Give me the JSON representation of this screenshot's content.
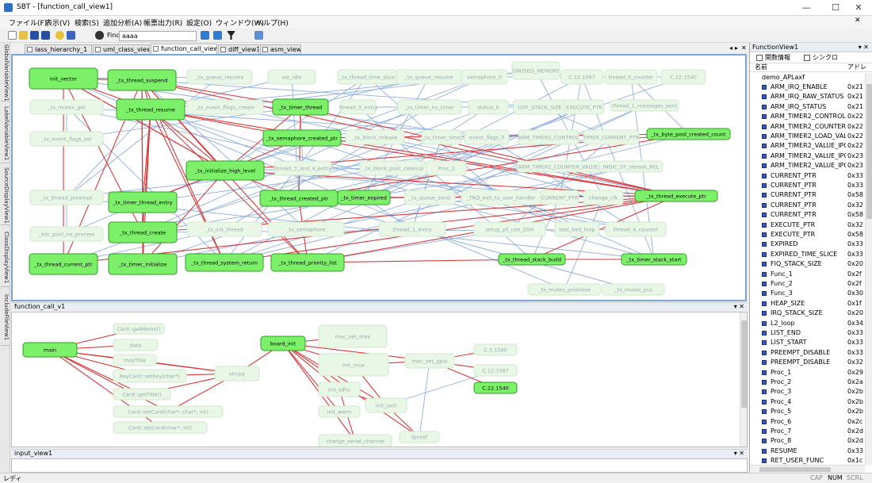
{
  "window": {
    "title": "SBT - [function_call_view1]",
    "min": "—",
    "max": "☐",
    "close": "✕"
  },
  "menu": [
    "ファイル(F)",
    "表示(V)",
    "検索(S)",
    "追加分析(A)",
    "帳票出力(R)",
    "設定(O)",
    "ウィンドウ(W)",
    "ヘルプ(H)"
  ],
  "toolbar": {
    "find_label": "Find",
    "find_value": "aaaa",
    "btn1": "PREV",
    "btn2": "NEXT"
  },
  "side_tabs": [
    "GlobalVariableView1",
    "LabelVariableView1",
    "SourceDisplayView1",
    "ClassDisplayView1",
    "IncludeFileView1"
  ],
  "tabs": [
    "lass_hierarchy_1",
    "uml_class_view",
    "function_call_view1",
    "diff_view1",
    "asm_view1"
  ],
  "tab_ctrl": {
    "left": "◂",
    "right": "▸",
    "close": "✕"
  },
  "graph1_nodes": [
    {
      "label": "init_vector",
      "hl": true
    },
    {
      "label": "_tx_thread_suspend",
      "hl": true
    },
    {
      "label": "_tx_thread_resume",
      "hl": true
    },
    {
      "label": "_tx_timer_thread",
      "hl": true
    },
    {
      "label": "_tx_semaphore_created_ptr",
      "hl": true
    },
    {
      "label": "_tx_initialize_high_level",
      "hl": true
    },
    {
      "label": "_tx_byte_pool_created_count",
      "hl": true
    },
    {
      "label": "_tx_thread_created_ptr",
      "hl": true
    },
    {
      "label": "_tx_timer_expired",
      "hl": true
    },
    {
      "label": "_tx_thread_execute_ptr",
      "hl": true
    },
    {
      "label": "_tx_timer_thread_entry",
      "hl": true
    },
    {
      "label": "_tx_thread_create",
      "hl": true
    },
    {
      "label": "_tx_thread_current_ptr",
      "hl": true
    },
    {
      "label": "_tx_timer_initialize",
      "hl": true
    },
    {
      "label": "_tx_thread_system_return",
      "hl": true
    },
    {
      "label": "_tx_thread_priority_list",
      "hl": true
    },
    {
      "label": "_tx_thread_stack_build",
      "hl": true
    },
    {
      "label": "_tx_timer_stack_start",
      "hl": true
    },
    {
      "label": "_tx_queue_resume",
      "hl": false
    },
    {
      "label": "ser_idle",
      "hl": false
    },
    {
      "label": "_tx_thread_time_slice",
      "hl": false
    },
    {
      "label": "_tx_queue_resume",
      "hl": false
    },
    {
      "label": "semaphore_0",
      "hl": false
    },
    {
      "label": "C.12.1587",
      "hl": false
    },
    {
      "label": "thread_0_counter",
      "hl": false
    },
    {
      "label": "C.22.1540",
      "hl": false
    },
    {
      "label": "UNUSED_MEMORY",
      "hl": false
    },
    {
      "label": "_tx_event_flags_create",
      "hl": false
    },
    {
      "label": "thread_0_entry",
      "hl": false
    },
    {
      "label": "_tx_timer_no_timer",
      "hl": false
    },
    {
      "label": "status_0",
      "hl": false
    },
    {
      "label": "UDF_STACK_SIZE",
      "hl": false
    },
    {
      "label": "EXECUTE_PTR",
      "hl": false
    },
    {
      "label": "thread_1_messages_sent",
      "hl": false
    },
    {
      "label": "_tx_block_release",
      "hl": false
    },
    {
      "label": "_tx_timer_time",
      "hl": false
    },
    {
      "label": "event_flags_0",
      "hl": false
    },
    {
      "label": "ARM_TIMER2_CONTROL",
      "hl": false
    },
    {
      "label": "TIMER_CURRENT_PTR",
      "hl": false
    },
    {
      "label": "thread_3_and_4_entry",
      "hl": false
    },
    {
      "label": "_tx_block_pool_cleanup",
      "hl": false
    },
    {
      "label": "Proc_2",
      "hl": false
    },
    {
      "label": "ARM_TIMER2_COUNTER_VALUE",
      "hl": false
    },
    {
      "label": "INDIC_ST_nbreak_REL",
      "hl": false
    },
    {
      "label": "_tx_queue_send",
      "hl": false
    },
    {
      "label": "_TRQ_exit_to_user_handler",
      "hl": false
    },
    {
      "label": "CURRENT_PTR",
      "hl": false
    },
    {
      "label": "change_clk",
      "hl": false
    },
    {
      "label": "_tx_init_thread",
      "hl": false
    },
    {
      "label": "_tx_semaphore",
      "hl": false
    },
    {
      "label": "thread_1_entry",
      "hl": false
    },
    {
      "label": "setup_pll_use_OSH",
      "hl": false
    },
    {
      "label": "test_bed_loop",
      "hl": false
    },
    {
      "label": "thread_4_counter",
      "hl": false
    },
    {
      "label": "_tx_mutex_prioritize",
      "hl": false
    },
    {
      "label": "_tx_mutex_put",
      "hl": false
    },
    {
      "label": "_tx_mutex_get",
      "hl": false
    },
    {
      "label": "_tx_event_flags_set",
      "hl": false
    },
    {
      "label": "_stlc_pool_no_process",
      "hl": false
    },
    {
      "label": "_tx_thread_preempt",
      "hl": false
    }
  ],
  "panel_function_call": {
    "title": "function_call_v1",
    "ctl": "▾ ✕"
  },
  "graph2_nodes": [
    {
      "label": "main",
      "hl": true
    },
    {
      "label": "Card::getMemo()",
      "hl": false
    },
    {
      "label": "data",
      "hl": false
    },
    {
      "label": "maxTitle",
      "hl": false
    },
    {
      "label": "KeyCard::setKey(char*)",
      "hl": false
    },
    {
      "label": "Card::getTitle()",
      "hl": false
    },
    {
      "label": "Card::setCard(char*, char*, int)",
      "hl": false
    },
    {
      "label": "Card::setCard(char*, int)",
      "hl": false
    },
    {
      "label": "strcpy",
      "hl": false
    },
    {
      "label": "board_init",
      "hl": true
    },
    {
      "label": "mac_set_max",
      "hl": false
    },
    {
      "label": "init_mux",
      "hl": false
    },
    {
      "label": "mac_set_gpio",
      "hl": false
    },
    {
      "label": "init_sdhc",
      "hl": false
    },
    {
      "label": "init_uart",
      "hl": false
    },
    {
      "label": "init_wwm",
      "hl": false
    },
    {
      "label": "change_serial_channel",
      "hl": false
    },
    {
      "label": "fprintf",
      "hl": false
    },
    {
      "label": "C.3.1540",
      "hl": false
    },
    {
      "label": "C.12.1587",
      "hl": false
    },
    {
      "label": "C.22.1540",
      "hl": true
    }
  ],
  "panel_input": {
    "title": "input_view1",
    "ctl": "▾ ✕"
  },
  "status": {
    "left": "レディ",
    "cap": "CAP",
    "num": "NUM",
    "scrl": "SCRL"
  },
  "function_view": {
    "title": "FunctionView1",
    "ctl": "▾ ✕",
    "check1": "関数情報",
    "check2": "シンクロ",
    "col_name": "名前",
    "col_addr": "アドレ",
    "root": "demo_APLaxf",
    "items": [
      {
        "name": "ARM_IRQ_ENABLE",
        "addr": "0x21"
      },
      {
        "name": "ARM_IRQ_RAW_STATUS",
        "addr": "0x21"
      },
      {
        "name": "ARM_IRQ_STATUS",
        "addr": "0x21"
      },
      {
        "name": "ARM_TIMER2_CONTROL",
        "addr": "0x22"
      },
      {
        "name": "ARM_TIMER2_COUNTER_...",
        "addr": "0x22"
      },
      {
        "name": "ARM_TIMER2_LOAD_VALUE",
        "addr": "0x22"
      },
      {
        "name": "ARM_TIMER2_VALUE_IPG...",
        "addr": "0x22"
      },
      {
        "name": "ARM_TIMER2_VALUE_IPG...",
        "addr": "0x23"
      },
      {
        "name": "ARM_TIMER2_VALUE_IPG...",
        "addr": "0x23"
      },
      {
        "name": "CURRENT_PTR",
        "addr": "0x33"
      },
      {
        "name": "CURRENT_PTR",
        "addr": "0x33"
      },
      {
        "name": "CURRENT_PTR",
        "addr": "0x58"
      },
      {
        "name": "CURRENT_PTR",
        "addr": "0x32"
      },
      {
        "name": "CURRENT_PTR",
        "addr": "0x58"
      },
      {
        "name": "EXECUTE_PTR",
        "addr": "0x32"
      },
      {
        "name": "EXECUTE_PTR",
        "addr": "0x58"
      },
      {
        "name": "EXPIRED",
        "addr": "0x33"
      },
      {
        "name": "EXPIRED_TIME_SLICE",
        "addr": "0x33"
      },
      {
        "name": "FIQ_STACK_SIZE",
        "addr": "0x20"
      },
      {
        "name": "Func_1",
        "addr": "0x2f"
      },
      {
        "name": "Func_2",
        "addr": "0x2f"
      },
      {
        "name": "Func_3",
        "addr": "0x30"
      },
      {
        "name": "HEAP_SIZE",
        "addr": "0x1f"
      },
      {
        "name": "IRQ_STACK_SIZE",
        "addr": "0x20"
      },
      {
        "name": "L2_loop",
        "addr": "0x34"
      },
      {
        "name": "LIST_END",
        "addr": "0x33"
      },
      {
        "name": "LIST_START",
        "addr": "0x33"
      },
      {
        "name": "PREEMPT_DISABLE",
        "addr": "0x33"
      },
      {
        "name": "PREEMPT_DISABLE",
        "addr": "0x32"
      },
      {
        "name": "Proc_1",
        "addr": "0x29"
      },
      {
        "name": "Proc_2",
        "addr": "0x2a"
      },
      {
        "name": "Proc_3",
        "addr": "0x2b"
      },
      {
        "name": "Proc_4",
        "addr": "0x2b"
      },
      {
        "name": "Proc_5",
        "addr": "0x2b"
      },
      {
        "name": "Proc_6",
        "addr": "0x2c"
      },
      {
        "name": "Proc_7",
        "addr": "0x2d"
      },
      {
        "name": "Proc_8",
        "addr": "0x2d"
      },
      {
        "name": "RESUME",
        "addr": "0x33"
      },
      {
        "name": "RET_USER_FUNC",
        "addr": "0x1c"
      }
    ]
  },
  "colors": {
    "node_green": "#7df06a",
    "node_border": "#2f9e26",
    "edge_red": "#d93a3a",
    "edge_blue": "#8fb0e0",
    "faint_node": "#e8f7e6"
  }
}
